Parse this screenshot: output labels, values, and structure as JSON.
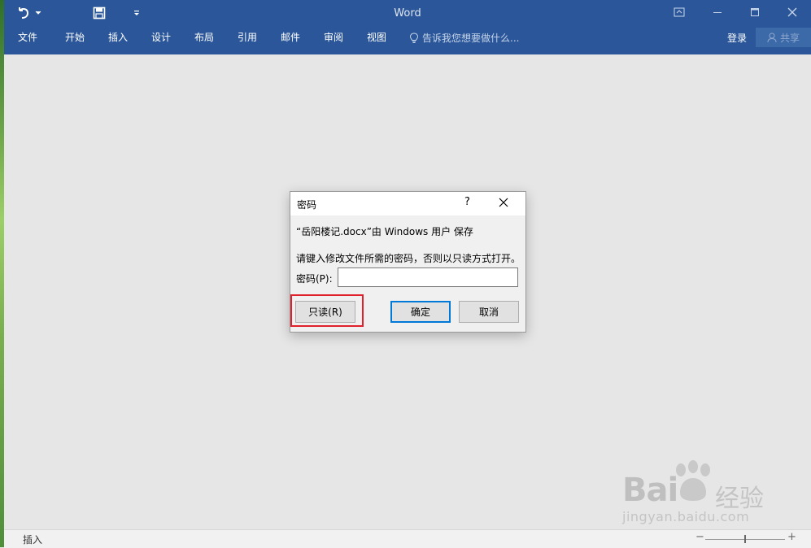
{
  "app": {
    "title": "Word"
  },
  "quick_access": [
    {
      "icon": "undo-icon"
    },
    {
      "icon": "dropdown-arrow-icon"
    },
    {
      "icon": "save-icon"
    },
    {
      "icon": "customize-qat-icon"
    }
  ],
  "window_controls": [
    "ribbon-display-options-icon",
    "minimize-icon",
    "maximize-icon",
    "close-icon"
  ],
  "menu": {
    "items": [
      "文件",
      "开始",
      "插入",
      "设计",
      "布局",
      "引用",
      "邮件",
      "审阅",
      "视图"
    ],
    "tell_me": "告诉我您想要做什么...",
    "login": "登录",
    "share": "共享"
  },
  "dialog": {
    "title": "密码",
    "help": "?",
    "owner_line": "“岳阳楼记.docx”由 Windows 用户 保存",
    "instruction": "请键入修改文件所需的密码，否则以只读方式打开。",
    "password_label": "密码(P):",
    "password_value": "",
    "readonly_button": "只读(R)",
    "ok_button": "确定",
    "cancel_button": "取消",
    "highlight_color": "#e0202a"
  },
  "statusbar": {
    "mode": "插入"
  },
  "watermark": {
    "brand": "Bai",
    "brand_cn": "经验",
    "url": "jingyan.baidu.com"
  },
  "colors": {
    "titlebar": "#2b579a",
    "canvas": "#e6e6e6",
    "primary_button_border": "#0078d7"
  }
}
